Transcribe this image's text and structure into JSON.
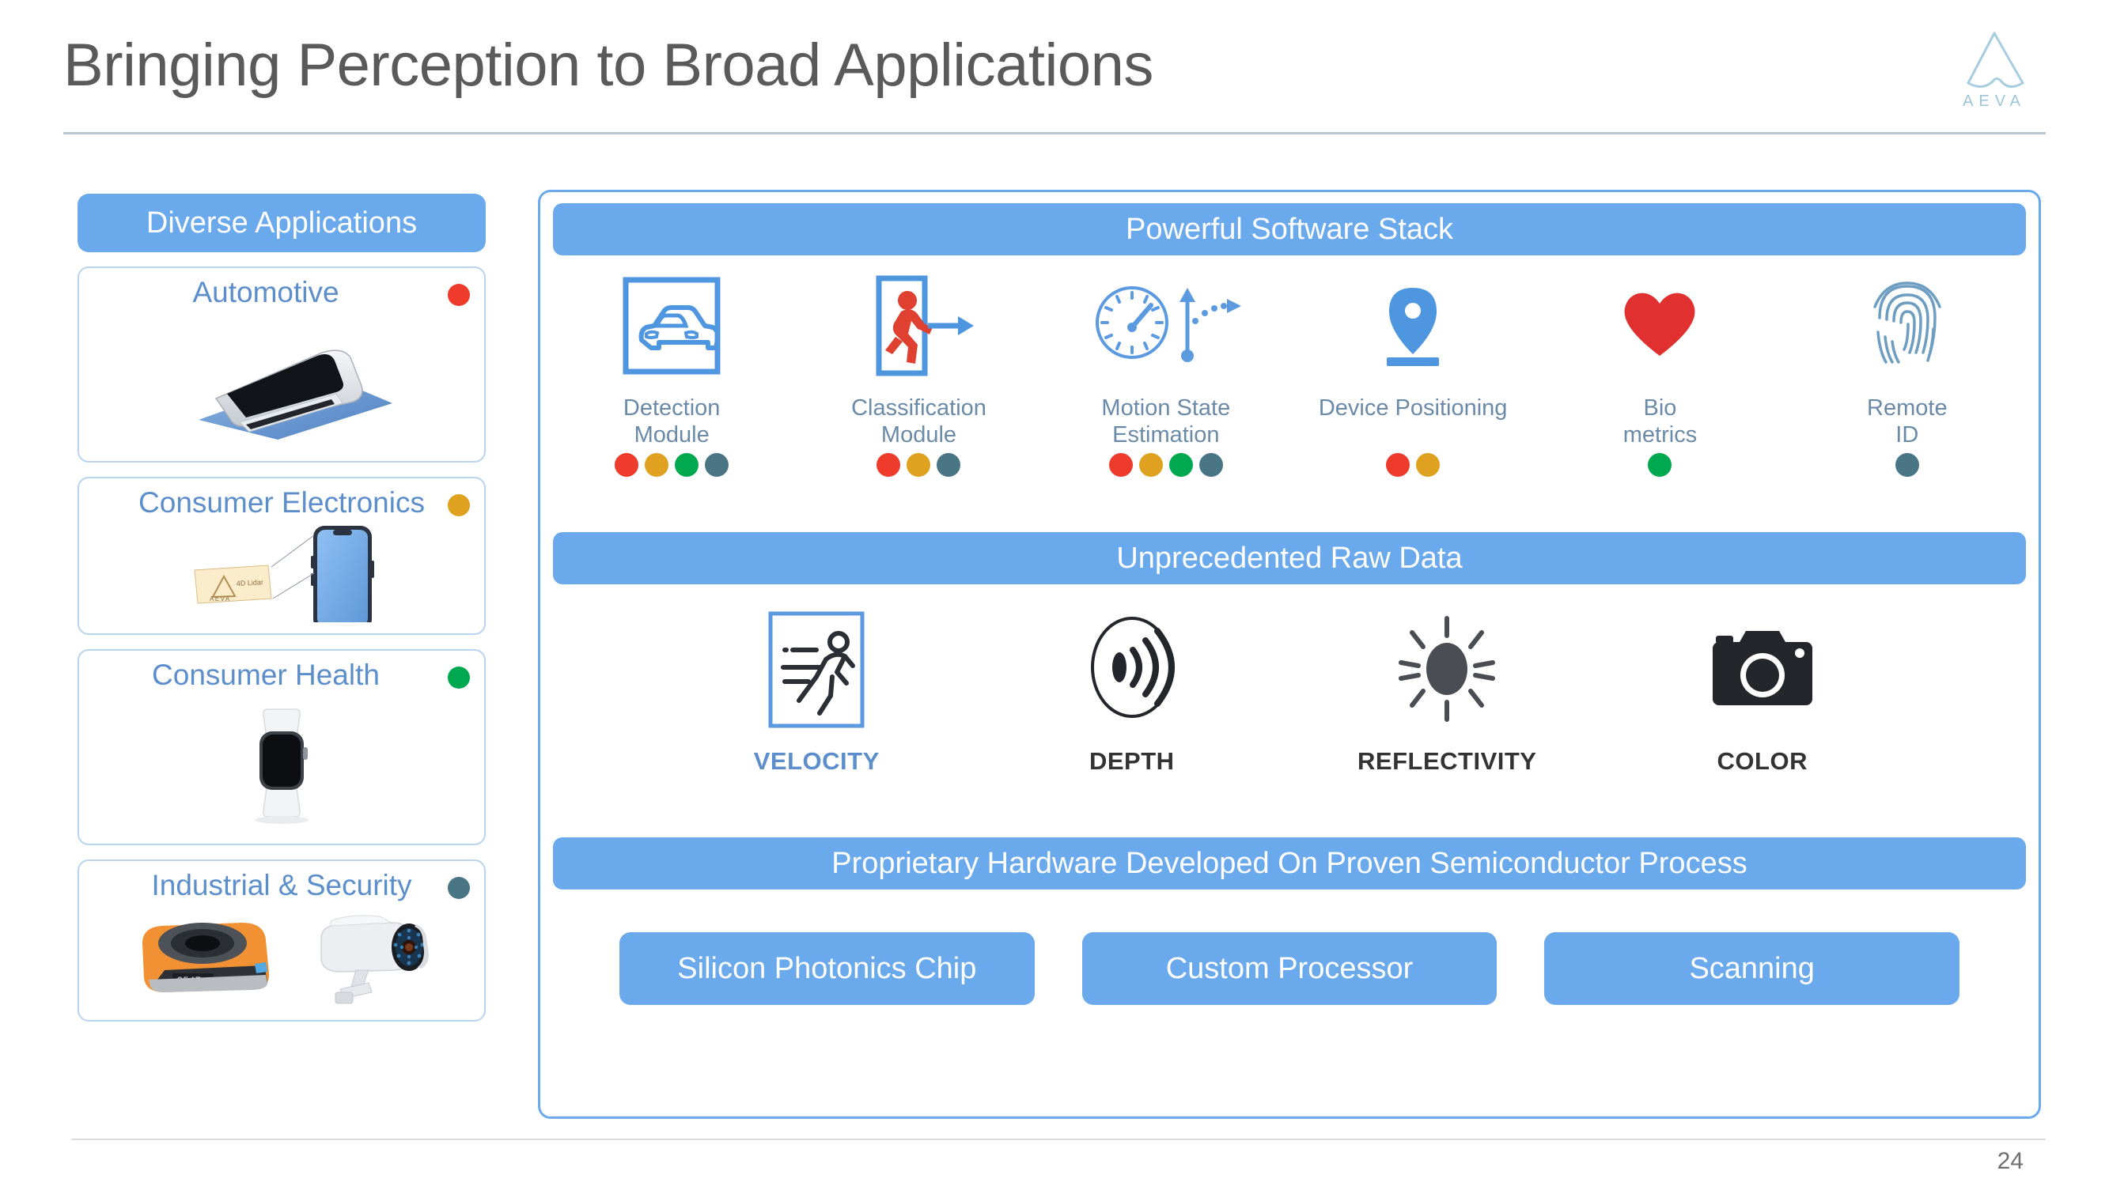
{
  "header": {
    "title": "Bringing Perception to Broad Applications",
    "logo_wordmark": "AEVA",
    "logo_icon": "aeva-triangle-logo"
  },
  "colors": {
    "brand_blue": "#6aaaec",
    "title_gray": "#5a5a5a",
    "card_title_blue": "#5b8ecb",
    "label_blue_gray": "#6a8aa8",
    "dot_red": "#ee3b2b",
    "dot_orange": "#e0a020",
    "dot_green": "#00a94f",
    "dot_teal": "#4a7585"
  },
  "left_column": {
    "banner_label": "Diverse Applications",
    "cards": [
      {
        "title": "Automotive",
        "dot_color": "#ee3b2b",
        "art": "automotive-lidar-sensor-photo"
      },
      {
        "title": "Consumer Electronics",
        "dot_color": "#e0a020",
        "art": "smartphone-with-lidar-chip-photo",
        "art_callout_lines": [
          "4D Lidar",
          "AEVA"
        ]
      },
      {
        "title": "Consumer Health",
        "dot_color": "#00a94f",
        "art": "smartwatch-photo"
      },
      {
        "title": "Industrial & Security",
        "dot_color": "#4a7585",
        "art": "industrial-scanner-and-security-camera-photo",
        "art_label": "2547"
      }
    ]
  },
  "panel": {
    "software_stack": {
      "band_label": "Powerful Software Stack",
      "modules": [
        {
          "label": "Detection\nModule",
          "label_line1": "Detection",
          "label_line2": "Module",
          "icon": "car-in-bounding-box-icon",
          "dots": [
            "#ee3b2b",
            "#e0a020",
            "#00a94f",
            "#4a7585"
          ]
        },
        {
          "label": "Classification\nModule",
          "label_line1": "Classification",
          "label_line2": "Module",
          "icon": "running-person-in-box-with-arrow-icon",
          "dots": [
            "#ee3b2b",
            "#e0a020",
            "#4a7585"
          ]
        },
        {
          "label": "Motion State\nEstimation",
          "label_line1": "Motion State",
          "label_line2": "Estimation",
          "icon": "speedometer-and-trajectory-arrow-icon",
          "dots": [
            "#ee3b2b",
            "#e0a020",
            "#00a94f",
            "#4a7585"
          ]
        },
        {
          "label": "Device Positioning",
          "label_line1": "Device Positioning",
          "label_line2": "",
          "icon": "map-pin-icon",
          "dots": [
            "#ee3b2b",
            "#e0a020"
          ]
        },
        {
          "label": "Bio\nmetrics",
          "label_line1": "Bio",
          "label_line2": "metrics",
          "icon": "heart-icon",
          "dots": [
            "#00a94f"
          ]
        },
        {
          "label": "Remote\nID",
          "label_line1": "Remote",
          "label_line2": "ID",
          "icon": "fingerprint-icon",
          "dots": [
            "#4a7585"
          ]
        }
      ]
    },
    "raw_data": {
      "band_label": "Unprecedented Raw Data",
      "items": [
        {
          "label": "VELOCITY",
          "icon": "running-person-motion-lines-icon",
          "highlighted": true
        },
        {
          "label": "DEPTH",
          "icon": "depth-waves-icon",
          "highlighted": false
        },
        {
          "label": "REFLECTIVITY",
          "icon": "sun-rays-icon",
          "highlighted": false
        },
        {
          "label": "COLOR",
          "icon": "camera-icon",
          "highlighted": false
        }
      ]
    },
    "hardware": {
      "band_label": "Proprietary Hardware Developed On Proven Semiconductor Process",
      "buttons": [
        {
          "label": "Silicon Photonics Chip"
        },
        {
          "label": "Custom Processor"
        },
        {
          "label": "Scanning"
        }
      ]
    }
  },
  "footer": {
    "page_number": "24"
  }
}
